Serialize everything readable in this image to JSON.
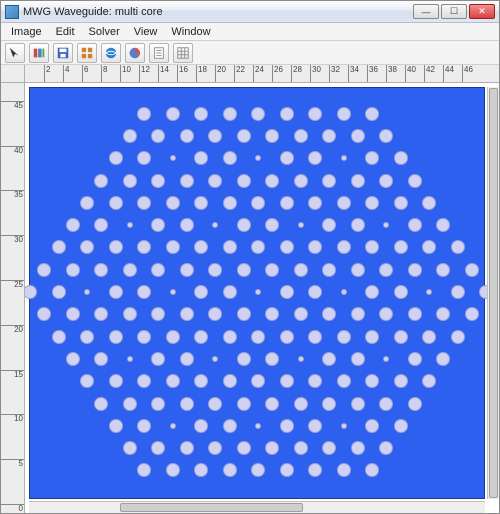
{
  "window": {
    "title": "MWG Waveguide: multi core"
  },
  "menu": {
    "items": [
      "Image",
      "Edit",
      "Solver",
      "View",
      "Window"
    ]
  },
  "ruler": {
    "x_ticks": [
      2,
      4,
      6,
      8,
      10,
      12,
      14,
      16,
      18,
      20,
      22,
      24,
      26,
      28,
      30,
      32,
      34,
      36,
      38,
      40,
      42,
      44,
      46
    ],
    "y_ticks": [
      0,
      5,
      10,
      15,
      20,
      25,
      30,
      35,
      40,
      45
    ]
  },
  "canvas": {
    "bg_color": "#2e60f0",
    "hole_color": "#cfd2f2",
    "x_range": [
      0,
      48
    ],
    "y_range": [
      0,
      48
    ],
    "lattice": {
      "type": "hexagonal-19core-pcf",
      "pitch": 3.0,
      "center": [
        24,
        24
      ],
      "rings": 8,
      "hole_radius_normal": 0.88,
      "defect_radius": 0.35,
      "defect_sites_axial": [
        [
          0,
          0
        ],
        [
          3,
          0
        ],
        [
          -3,
          0
        ],
        [
          0,
          3
        ],
        [
          0,
          -3
        ],
        [
          3,
          -3
        ],
        [
          -3,
          3
        ],
        [
          6,
          0
        ],
        [
          -6,
          0
        ],
        [
          0,
          6
        ],
        [
          0,
          -6
        ],
        [
          6,
          -6
        ],
        [
          -6,
          6
        ],
        [
          3,
          3
        ],
        [
          -3,
          -3
        ],
        [
          6,
          -3
        ],
        [
          -6,
          3
        ],
        [
          3,
          -6
        ],
        [
          -3,
          6
        ]
      ]
    }
  }
}
